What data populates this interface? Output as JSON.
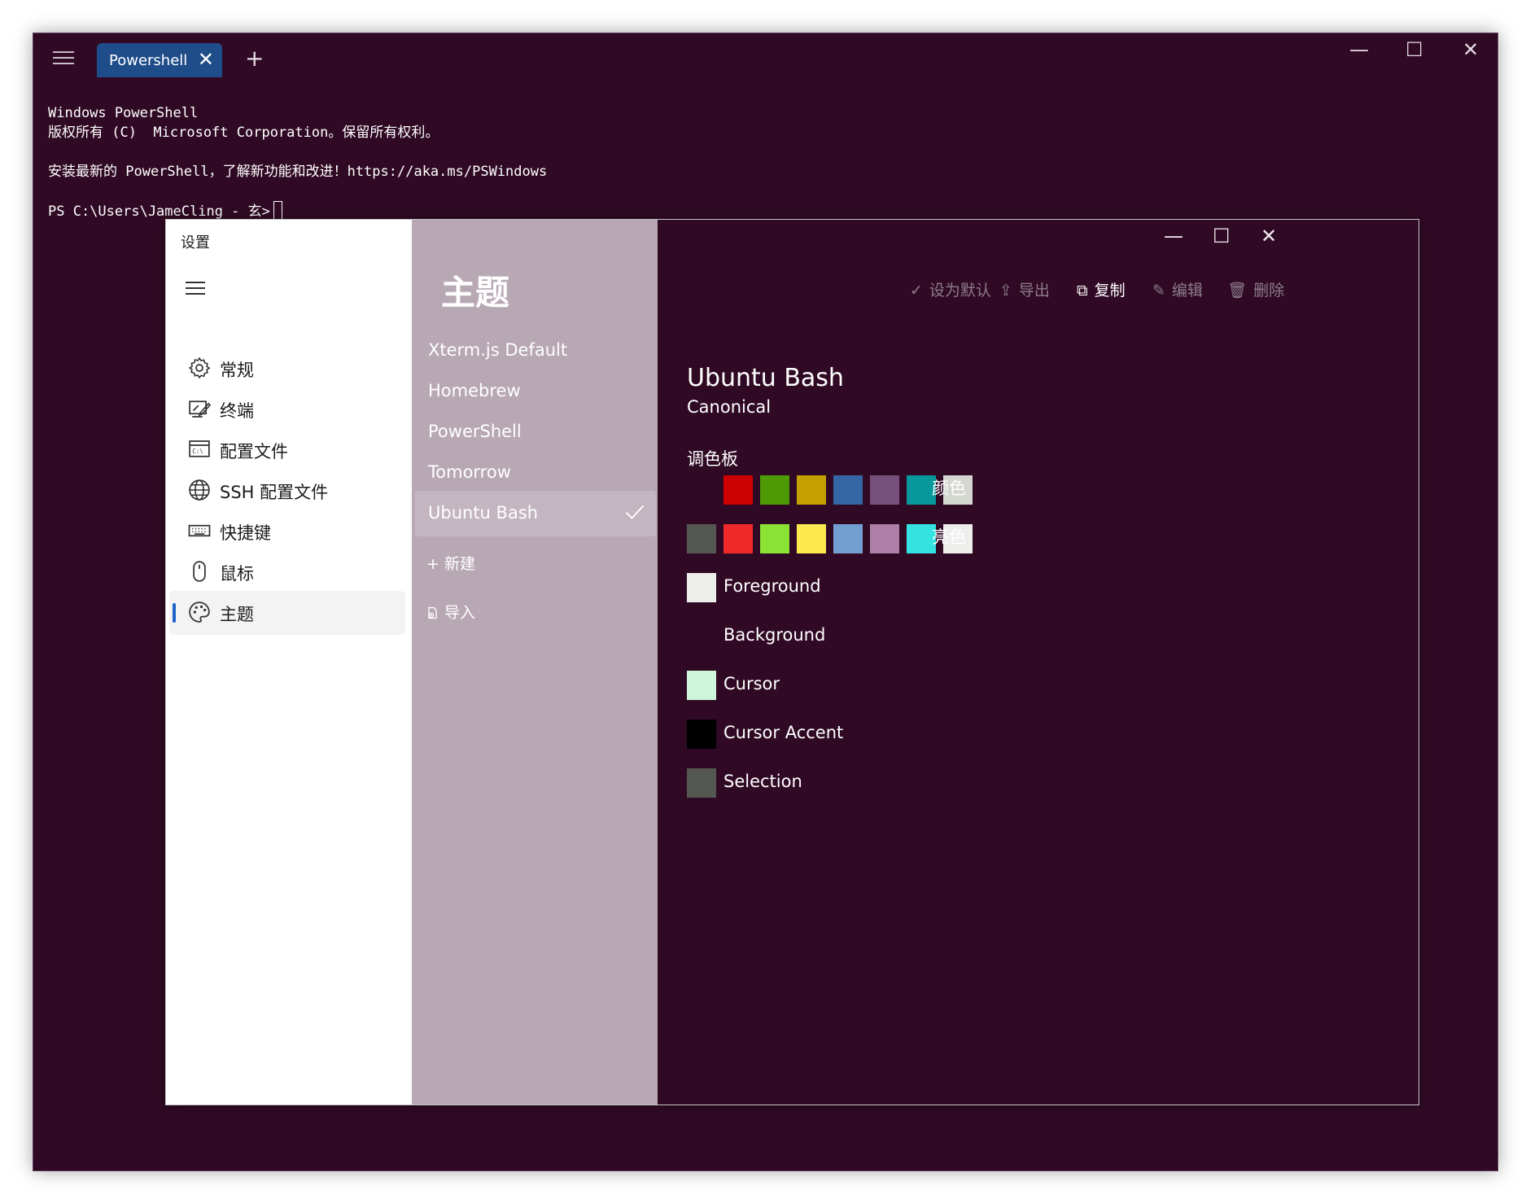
{
  "window": {
    "tab_label": "Powershell",
    "tab_close": "✕",
    "new_tab": "+",
    "minimize": "—",
    "maximize": "☐",
    "close": "✕"
  },
  "console": {
    "lines": [
      "Windows PowerShell",
      "版权所有 (C)  Microsoft Corporation。保留所有权利。",
      "",
      "安装最新的 PowerShell，了解新功能和改进！https://aka.ms/PSWindows",
      ""
    ],
    "prompt": "PS C:\\Users\\JameCling - 玄>"
  },
  "settings": {
    "title": "设置",
    "nav": [
      {
        "label": "常规",
        "icon": "gear-icon"
      },
      {
        "label": "终端",
        "icon": "terminal-edit-icon"
      },
      {
        "label": "配置文件",
        "icon": "profile-window-icon"
      },
      {
        "label": "SSH 配置文件",
        "icon": "globe-icon"
      },
      {
        "label": "快捷键",
        "icon": "keyboard-icon"
      },
      {
        "label": "鼠标",
        "icon": "mouse-icon"
      },
      {
        "label": "主题",
        "icon": "palette-icon",
        "selected": true
      }
    ]
  },
  "themes": {
    "heading": "主题",
    "items": [
      "Xterm.js Default",
      "Homebrew",
      "PowerShell",
      "Tomorrow",
      "Ubuntu Bash"
    ],
    "selected": "Ubuntu Bash",
    "new_label": "+ 新建",
    "import_label": "导入"
  },
  "toolbar": {
    "set_default": "设为默认",
    "export": "导出",
    "copy": "复制",
    "edit": "编辑",
    "delete": "删除"
  },
  "detail": {
    "name": "Ubuntu Bash",
    "author": "Canonical",
    "palette_label": "调色板",
    "normal_label": "颜色",
    "bright_label": "亮色",
    "normal_colors": [
      "#300a24",
      "#cc0000",
      "#4e9a06",
      "#c4a000",
      "#3465a4",
      "#75507b",
      "#06989a",
      "#d3d7cf"
    ],
    "bright_colors": [
      "#555753",
      "#ef2929",
      "#8ae234",
      "#fce94f",
      "#729fcf",
      "#ad7fa8",
      "#34e2e2",
      "#eeeeec"
    ],
    "special": [
      {
        "label": "Foreground",
        "color": "#eeeeec"
      },
      {
        "label": "Background",
        "color": "#300a24"
      },
      {
        "label": "Cursor",
        "color": "#cff5db"
      },
      {
        "label": "Cursor Accent",
        "color": "#000000"
      },
      {
        "label": "Selection",
        "color": "#555753"
      }
    ]
  }
}
